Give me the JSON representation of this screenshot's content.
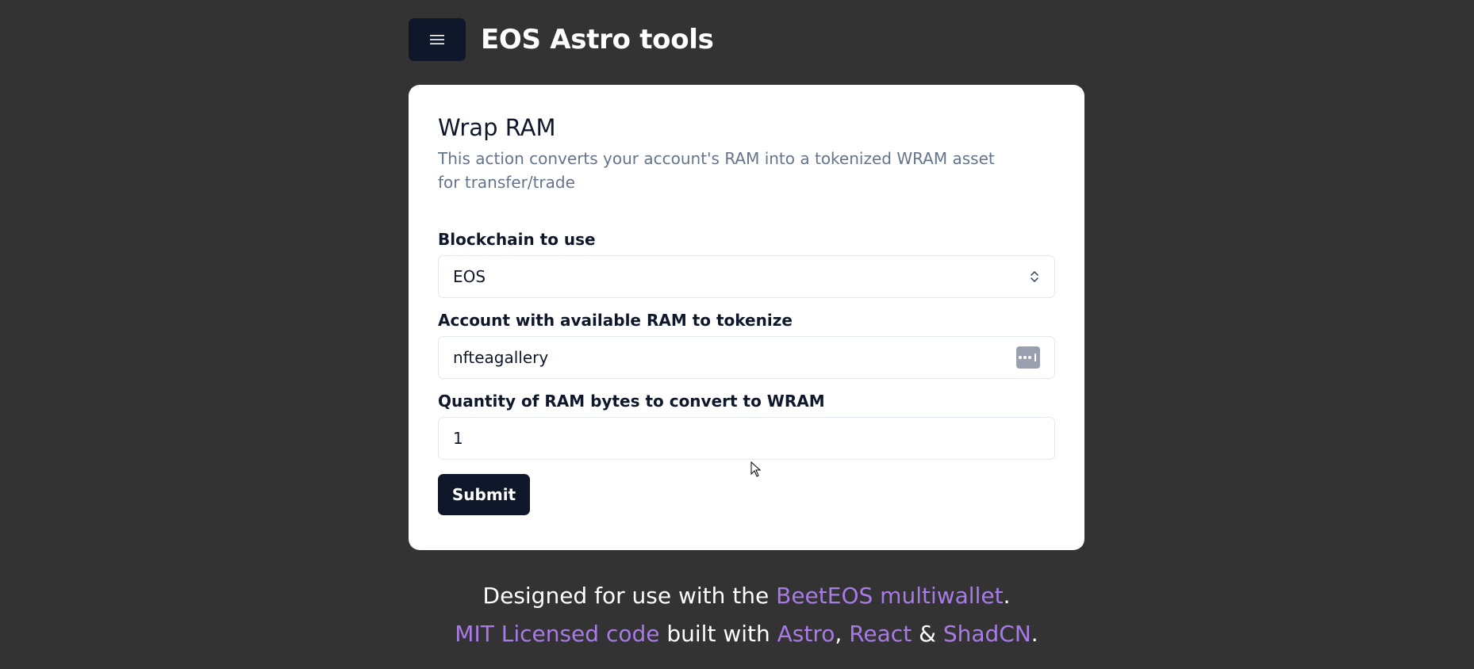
{
  "header": {
    "menu_icon": "hamburger-menu-icon",
    "title": "EOS Astro tools"
  },
  "card": {
    "title": "Wrap RAM",
    "description": "This action converts your account's RAM into a tokenized WRAM asset for transfer/trade",
    "fields": {
      "blockchain": {
        "label": "Blockchain to use",
        "value": "EOS",
        "icon": "chevrons-up-down-icon"
      },
      "account": {
        "label": "Account with available RAM to tokenize",
        "value": "nfteagallery",
        "icon": "password-manager-icon"
      },
      "quantity": {
        "label": "Quantity of RAM bytes to convert to WRAM",
        "value": "1"
      }
    },
    "submit_label": "Submit"
  },
  "footer": {
    "line1_prefix": "Designed for use with the ",
    "line1_link": "BeetEOS multiwallet",
    "line1_suffix": ".",
    "line2_link1": "MIT Licensed code",
    "line2_text1": " built with ",
    "line2_link2": "Astro",
    "line2_sep1": ", ",
    "line2_link3": "React",
    "line2_sep2": " & ",
    "line2_link4": "ShadCN",
    "line2_suffix": "."
  },
  "colors": {
    "background": "#333333",
    "primary": "#0f172a",
    "muted": "#64748b",
    "link": "#a87be6"
  }
}
